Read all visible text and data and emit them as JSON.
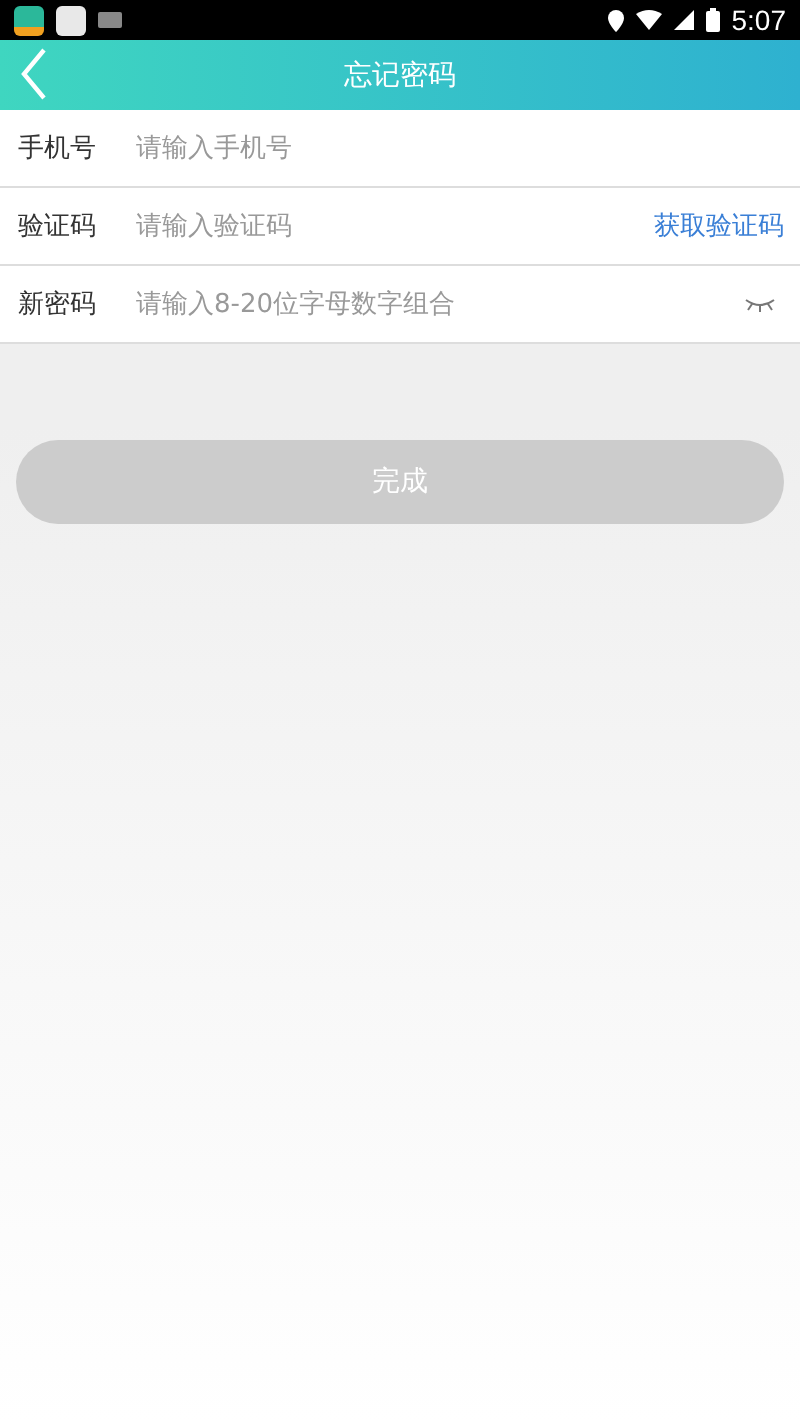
{
  "status_bar": {
    "time": "5:07"
  },
  "header": {
    "title": "忘记密码"
  },
  "fields": [
    {
      "kind": "text",
      "label": "手机号",
      "placeholder": "请输入手机号"
    },
    {
      "kind": "code",
      "label": "验证码",
      "placeholder": "请输入验证码",
      "action": "获取验证码"
    },
    {
      "kind": "password",
      "label": "新密码",
      "placeholder": "请输入8-20位字母数字组合"
    }
  ],
  "submit": {
    "label": "完成",
    "disabled": true
  }
}
